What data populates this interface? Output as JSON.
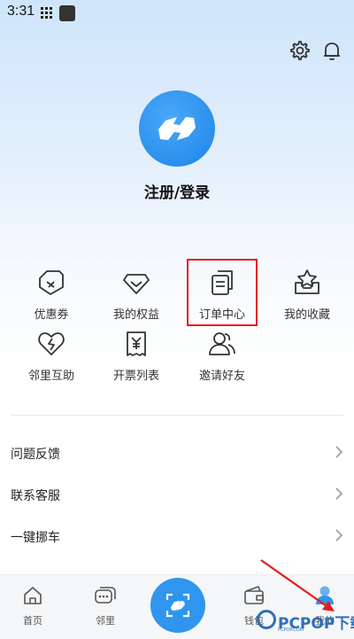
{
  "status_bar": {
    "time": "3:31"
  },
  "header": {
    "settings_icon": "gear-icon",
    "notification_icon": "bell-icon"
  },
  "profile": {
    "login_label": "注册/登录"
  },
  "features": [
    {
      "label": "优惠券",
      "icon": "coupon-icon"
    },
    {
      "label": "我的权益",
      "icon": "diamond-icon"
    },
    {
      "label": "订单中心",
      "icon": "orders-icon"
    },
    {
      "label": "我的收藏",
      "icon": "favorites-icon"
    },
    {
      "label": "邻里互助",
      "icon": "heart-icon"
    },
    {
      "label": "开票列表",
      "icon": "invoice-icon"
    },
    {
      "label": "邀请好友",
      "icon": "invite-icon"
    }
  ],
  "menu": [
    {
      "label": "问题反馈"
    },
    {
      "label": "联系客服"
    },
    {
      "label": "一键挪车"
    }
  ],
  "bottom_nav": {
    "tabs": [
      {
        "label": "首页",
        "icon": "home-icon"
      },
      {
        "label": "邻里",
        "icon": "chat-icon"
      },
      {
        "label": "钱包",
        "icon": "wallet-icon"
      },
      {
        "label": "我的",
        "icon": "profile-icon"
      }
    ],
    "scan_icon": "scan-icon"
  },
  "watermark": {
    "text": "PCPOP下载",
    "sub": "PCPOP.COM"
  },
  "colors": {
    "accent": "#2f95ee",
    "highlight": "#e41b1b"
  }
}
